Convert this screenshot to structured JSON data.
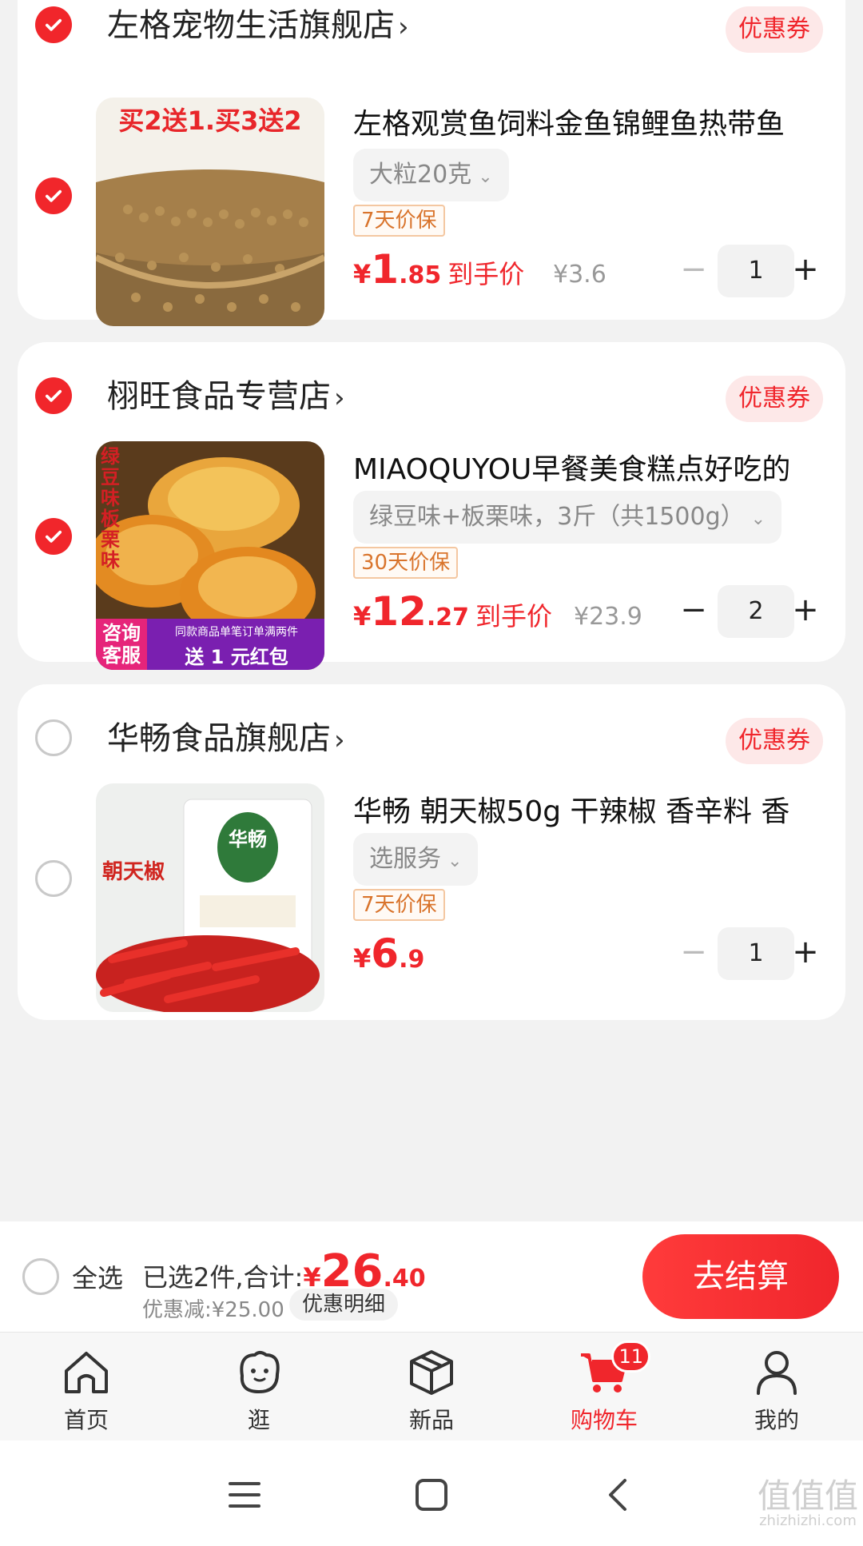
{
  "stores": [
    {
      "name": "左格宠物生活旗舰店",
      "coupon": "优惠券",
      "checked": true,
      "item": {
        "title": "左格观赏鱼饲料金鱼锦鲤鱼热带鱼",
        "spec": "大粒20克",
        "tag": "7天价保",
        "price_int": "1",
        "price_dec": ".85",
        "price_label": "到手价",
        "orig_price": "¥3.6",
        "qty": "1",
        "thumb_caption": "买2送1.买3送2"
      }
    },
    {
      "name": "栩旺食品专营店",
      "coupon": "优惠券",
      "checked": true,
      "item": {
        "title": "MIAOQUYOU早餐美食糕点好吃的",
        "spec": "绿豆味+板栗味，3斤（共1500g）",
        "tag": "30天价保",
        "price_int": "12",
        "price_dec": ".27",
        "price_label": "到手价",
        "orig_price": "¥23.9",
        "qty": "2",
        "thumb_top": "绿豆味 板栗味",
        "thumb_badge": "咨询客服",
        "thumb_promo_small": "同款商品单笔订单满两件",
        "thumb_promo": "送 1 元红包"
      }
    },
    {
      "name": "华畅食品旗舰店",
      "coupon": "优惠券",
      "checked": false,
      "item": {
        "title": "华畅 朝天椒50g 干辣椒 香辛料 香",
        "spec": "选服务",
        "tag": "7天价保",
        "price_int": "6",
        "price_dec": ".9",
        "qty": "1",
        "thumb_label": "朝天椒",
        "thumb_brand": "华畅"
      }
    }
  ],
  "currency": "¥",
  "summary": {
    "select_all": "全选",
    "selected_text": "已选2件,合计:",
    "total_int": "26",
    "total_dec": ".40",
    "discount": "优惠减:¥25.00",
    "discount_detail": "优惠明细",
    "checkout": "去结算"
  },
  "tabs": [
    {
      "label": "首页",
      "icon": "home-icon"
    },
    {
      "label": "逛",
      "icon": "stroll-icon"
    },
    {
      "label": "新品",
      "icon": "new-products-icon"
    },
    {
      "label": "购物车",
      "icon": "cart-icon",
      "badge": "11",
      "active": true
    },
    {
      "label": "我的",
      "icon": "profile-icon"
    }
  ],
  "watermark": {
    "main": "值值值",
    "sub": "zhizhizhi.com"
  },
  "colors": {
    "accent": "#f0262c",
    "tag": "#d9742c",
    "coupon_bg": "#fde8e8"
  }
}
